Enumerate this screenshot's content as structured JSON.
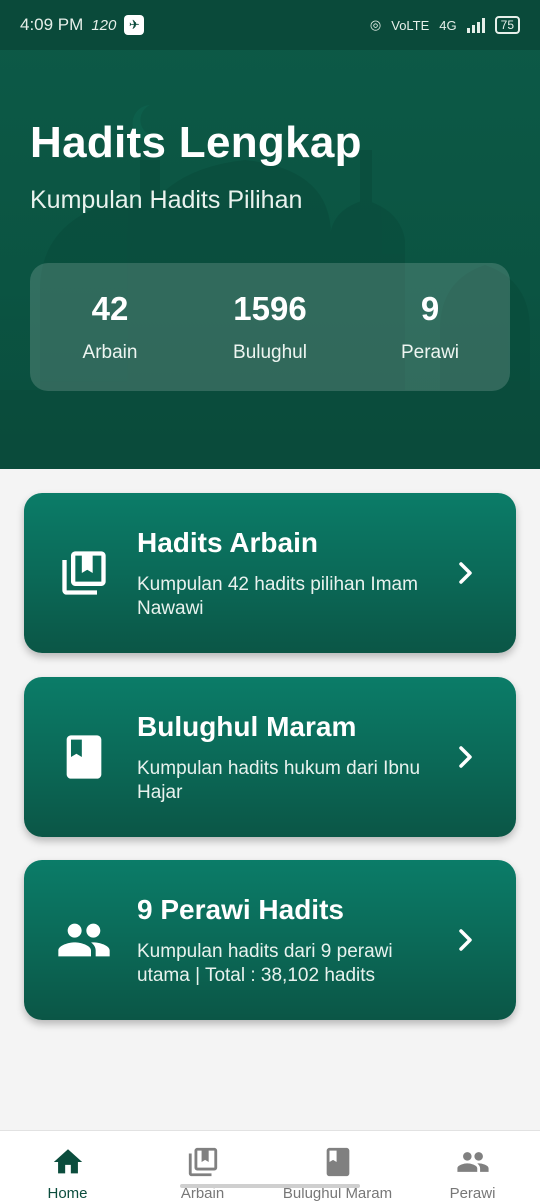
{
  "status_bar": {
    "time": "4:09 PM",
    "speed": "120",
    "network": "VoLTE",
    "network_gen": "4G",
    "battery": "75"
  },
  "header": {
    "title": "Hadits Lengkap",
    "subtitle": "Kumpulan Hadits Pilihan",
    "stats": [
      {
        "value": "42",
        "label": "Arbain"
      },
      {
        "value": "1596",
        "label": "Bulughul"
      },
      {
        "value": "9",
        "label": "Perawi"
      }
    ]
  },
  "menu": [
    {
      "title": "Hadits Arbain",
      "desc": "Kumpulan 42 hadits pilihan Imam Nawawi",
      "icon": "library-books-icon"
    },
    {
      "title": "Bulughul Maram",
      "desc": "Kumpulan hadits hukum dari Ibnu Hajar",
      "icon": "book-icon"
    },
    {
      "title": "9 Perawi Hadits",
      "desc": "Kumpulan hadits dari 9 perawi utama  | Total : 38,102 hadits",
      "icon": "people-icon"
    }
  ],
  "bottom_nav": [
    {
      "label": "Home",
      "icon": "home-icon",
      "active": true
    },
    {
      "label": "Arbain",
      "icon": "library-books-icon",
      "active": false
    },
    {
      "label": "Bulughul Maram",
      "icon": "book-icon",
      "active": false
    },
    {
      "label": "Perawi",
      "icon": "people-icon",
      "active": false
    }
  ],
  "colors": {
    "primary": "#0b5442",
    "card": "#0b6a58",
    "active_nav": "#0b4d3d"
  }
}
